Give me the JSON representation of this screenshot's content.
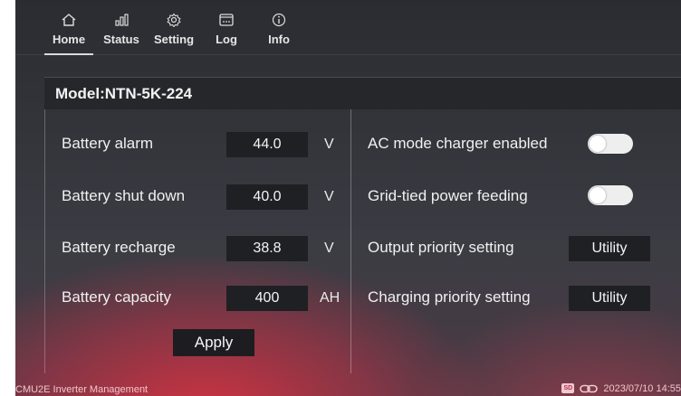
{
  "nav": {
    "tabs": [
      {
        "label": "Home",
        "icon": "home-icon"
      },
      {
        "label": "Status",
        "icon": "bar-chart-icon"
      },
      {
        "label": "Setting",
        "icon": "gear-icon"
      },
      {
        "label": "Log",
        "icon": "log-icon"
      },
      {
        "label": "Info",
        "icon": "info-icon"
      }
    ],
    "active": "Home"
  },
  "model": "Model:NTN-5K-224",
  "battery": [
    {
      "label": "Battery alarm",
      "value": "44.0",
      "unit": "V"
    },
    {
      "label": "Battery shut down",
      "value": "40.0",
      "unit": "V"
    },
    {
      "label": "Battery recharge",
      "value": "38.8",
      "unit": "V"
    },
    {
      "label": "Battery capacity",
      "value": "400",
      "unit": "AH"
    }
  ],
  "apply_label": "Apply",
  "settings": [
    {
      "label": "AC mode charger enabled",
      "type": "toggle",
      "on": false
    },
    {
      "label": "Grid-tied power feeding",
      "type": "toggle",
      "on": false
    },
    {
      "label": "Output priority setting",
      "type": "select",
      "value": "Utility"
    },
    {
      "label": "Charging priority setting",
      "type": "select",
      "value": "Utility"
    }
  ],
  "footer": {
    "app_name": "CMU2E Inverter Management",
    "sd_label": "SD",
    "datetime": "2023/07/10 14:55"
  },
  "colors": {
    "accent_red": "#d73241",
    "panel_dark": "#1f2024"
  }
}
